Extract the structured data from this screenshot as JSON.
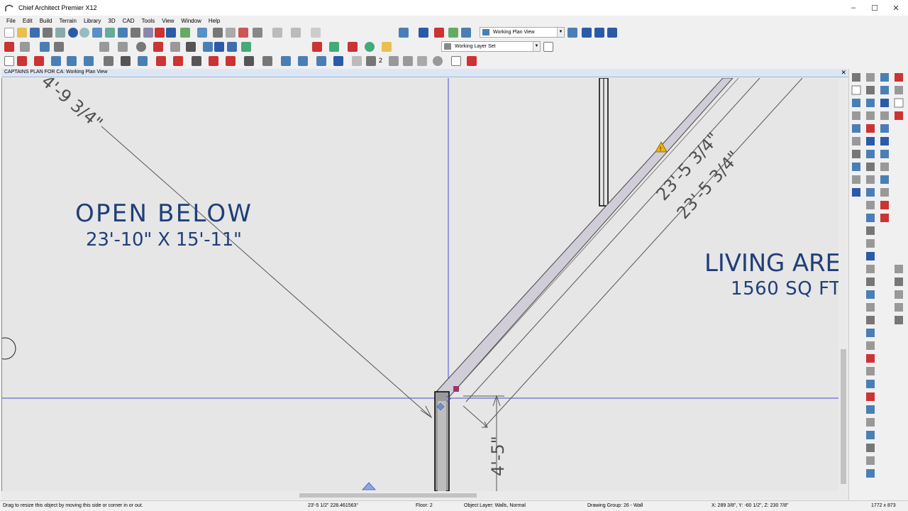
{
  "window": {
    "title": "Chief Architect Premier X12",
    "controls": {
      "minimize": "–",
      "maximize": "☐",
      "close": "✕"
    }
  },
  "menu": [
    "File",
    "Edit",
    "Build",
    "Terrain",
    "Library",
    "3D",
    "CAD",
    "Tools",
    "View",
    "Window",
    "Help"
  ],
  "toolbar": {
    "view_select": "Working Plan View",
    "layer_select": "Working Layer Set",
    "step_number": "2"
  },
  "document": {
    "title": "CAPTAINS PLAN FOR CA:  Working Plan View",
    "close": "✕"
  },
  "plan": {
    "room1_name": "OPEN BELOW",
    "room1_size": "23'-10\" X 15'-11\"",
    "room2_name": "LIVING ARE",
    "room2_area": "1560 SQ FT",
    "dim_top_left": "4'-9 3/4\"",
    "dim_diag_1": "23'-5 3/4\"",
    "dim_diag_2": "23'-5 3/4\"",
    "dim_vertical": "4'-5\"",
    "warning_color": "#f0b400",
    "text_color": "#1f3f7a"
  },
  "status": {
    "hint": "Drag to resize this object by moving this side or corner in or out.",
    "measure": "23'-5 1/2\" 228.461563°",
    "floor": "Floor: 2",
    "object_layer": "Object Layer: Walls,  Normal",
    "drawing_group": "Drawing Group: 26 - Wall",
    "coords": "X: 289 3/8\", Y: -60 1/2\", Z: 230 7/8\"",
    "size": "1772 x 873"
  }
}
